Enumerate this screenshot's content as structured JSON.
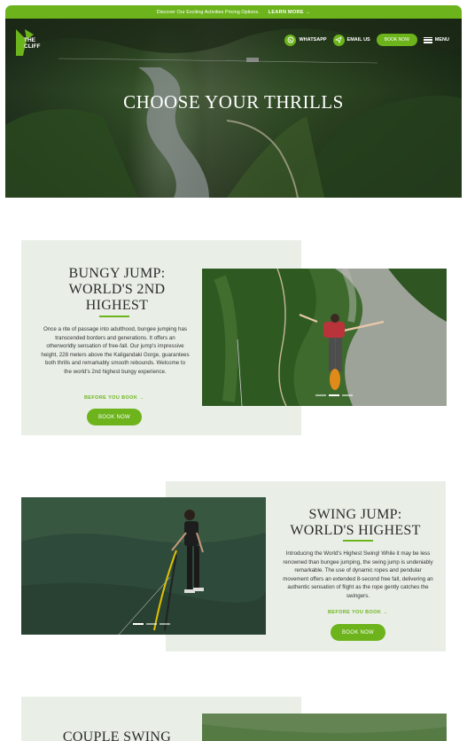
{
  "promo": {
    "text": "Discover Our Exciting Activities Pricing Options.",
    "link": "LEARN MORE →"
  },
  "header": {
    "logo_line1": "THE",
    "logo_line2": "CLIFF",
    "whatsapp": "WHATSAPP",
    "email": "EMAIL US",
    "book": "BOOK NOW",
    "menu": "MENU"
  },
  "hero": {
    "title": "CHOOSE YOUR THRILLS"
  },
  "activities": [
    {
      "title_line1": "BUNGY JUMP:",
      "title_line2": "WORLD'S 2ND",
      "title_line3": "HIGHEST",
      "description": "Once a rite of passage into adulthood, bungee jumping has transcended borders and generations. It offers an otherworldly sensation of free-fall. Our jump's impressive height, 228 meters above the Kaligandaki Gorge, guarantees both thrills and remarkably smooth rebounds. Welcome to the world's 2nd highest bungy experience.",
      "before": "BEFORE YOU BOOK →",
      "cta": "BOOK NOW"
    },
    {
      "title_line1": "SWING JUMP:",
      "title_line2": "WORLD'S HIGHEST",
      "description": "Introducing the World's Highest Swing! While it may be less renowned than bungee jumping, the swing jump is undeniably remarkable. The use of dynamic ropes and pendular movement offers an extended 8-second free fall, delivering an authentic sensation of flight as the rope gently catches the swingers.",
      "before": "BEFORE YOU BOOK →",
      "cta": "BOOK NOW"
    },
    {
      "title_line1": "COUPLE SWING"
    }
  ],
  "colors": {
    "accent": "#6cb31c",
    "panel": "#e9efe7"
  }
}
